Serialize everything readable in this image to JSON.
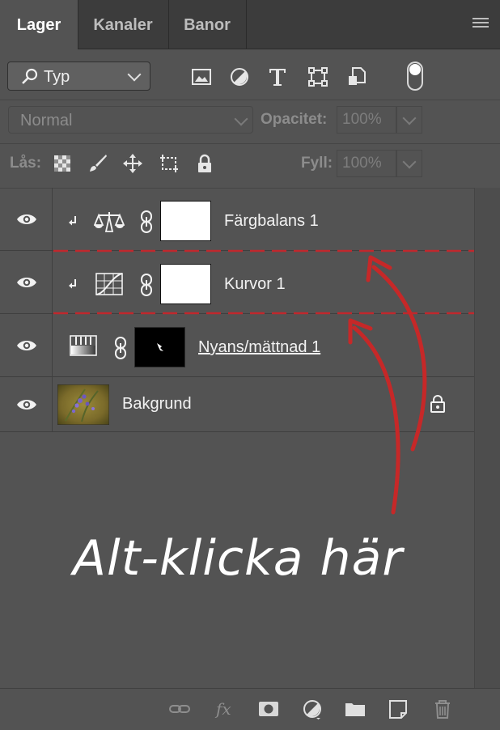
{
  "tabs": [
    {
      "label": "Lager",
      "active": true
    },
    {
      "label": "Kanaler",
      "active": false
    },
    {
      "label": "Banor",
      "active": false
    }
  ],
  "filter": {
    "selected": "Typ",
    "icons": [
      "image-filter-icon",
      "adjustment-filter-icon",
      "type-filter-icon",
      "shape-filter-icon",
      "smart-object-filter-icon"
    ]
  },
  "blend": {
    "mode": "Normal",
    "opacity_label": "Opacitet:",
    "opacity_value": "100%"
  },
  "lock": {
    "label": "Lås:",
    "fill_label": "Fyll:",
    "fill_value": "100%"
  },
  "layers": [
    {
      "name": "Färgbalans 1",
      "type": "color-balance",
      "clipped": true
    },
    {
      "name": "Kurvor 1",
      "type": "curves",
      "clipped": true
    },
    {
      "name": "Nyans/mättnad 1",
      "type": "hue-saturation",
      "clipped": false
    },
    {
      "name": "Bakgrund",
      "type": "background",
      "locked": true
    }
  ],
  "annotation": "Alt-klicka här",
  "colors": {
    "panel": "#535353",
    "tabbar": "#3c3c3c",
    "guide": "#c0282d",
    "arrow": "#c62828"
  }
}
